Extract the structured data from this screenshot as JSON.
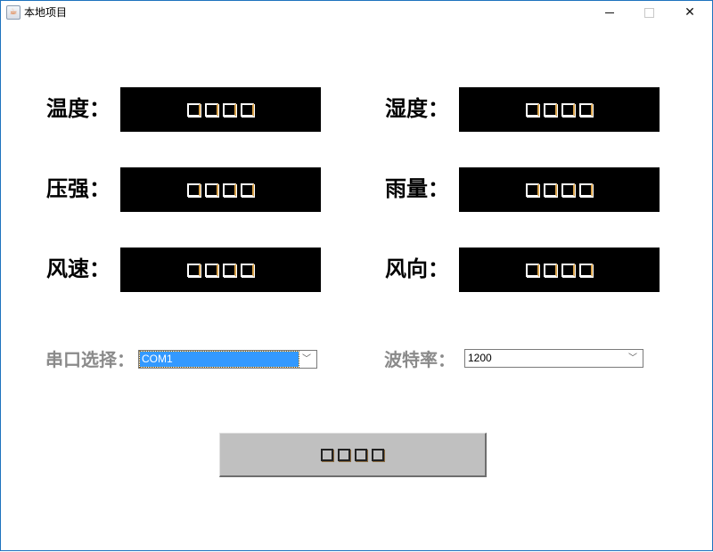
{
  "window": {
    "title": "本地项目",
    "icon": "java-cup-icon",
    "controls": {
      "minimize": "minimize-icon",
      "maximize": "maximize-icon",
      "close": "✕"
    }
  },
  "readings": [
    {
      "label": "温度：",
      "value": "□□□□"
    },
    {
      "label": "湿度：",
      "value": "□□□□"
    },
    {
      "label": "压强：",
      "value": "□□□□"
    },
    {
      "label": "雨量：",
      "value": "□□□□"
    },
    {
      "label": "风速：",
      "value": "□□□□"
    },
    {
      "label": "风向：",
      "value": "□□□□"
    }
  ],
  "serial": {
    "port_label": "串口选择：",
    "port_value": "COM1",
    "baud_label": "波特率：",
    "baud_value": "1200",
    "dropdown_icon": "chevron-down-icon"
  },
  "actions": {
    "start_label": "□□□□"
  },
  "colors": {
    "window_border": "#1e73be",
    "display_bg": "#000000",
    "selection": "#3399ff",
    "button_bg": "#c0c0c0",
    "muted_label": "#8a8a8a"
  }
}
